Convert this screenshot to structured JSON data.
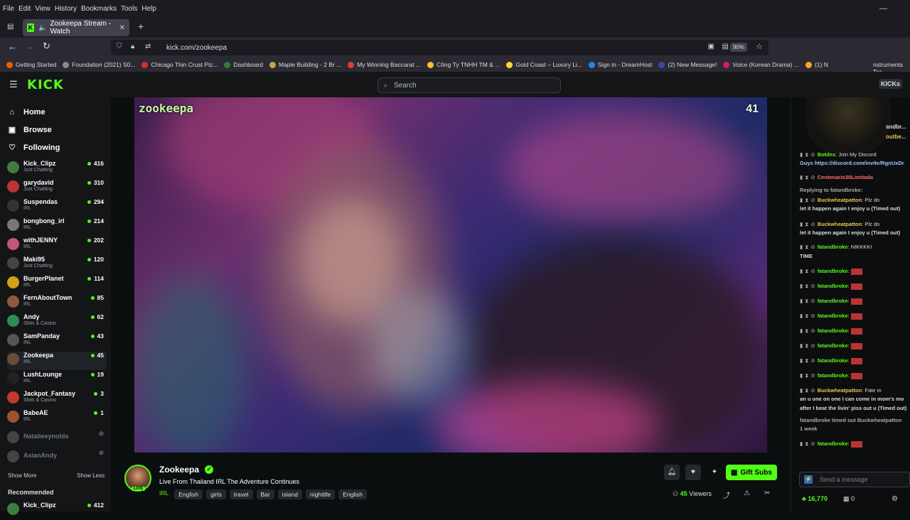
{
  "browser": {
    "menu": [
      "File",
      "Edit",
      "View",
      "History",
      "Bookmarks",
      "Tools",
      "Help"
    ],
    "tab_title": "Zookeepa Stream - Watch",
    "url": "kick.com/zookeepa",
    "zoom": "90%",
    "bookmarks": [
      {
        "label": "Getting Started",
        "color": "#e66000"
      },
      {
        "label": "Foundation (2021) S0...",
        "color": "#8a8a8a"
      },
      {
        "label": "Chicago Thin Crust Piz...",
        "color": "#d32f2f"
      },
      {
        "label": "Dashboard",
        "color": "#2e7d32"
      },
      {
        "label": "Maple Building - 2 Br ...",
        "color": "#c8a24a"
      },
      {
        "label": "My Winning Baccarat ...",
        "color": "#e53935"
      },
      {
        "label": "Công Ty TNHH TM & ...",
        "color": "#fbc02d"
      },
      {
        "label": "Gold Coast – Luxury Li...",
        "color": "#fdd835"
      },
      {
        "label": "Sign in - DreamHost",
        "color": "#1e88e5"
      },
      {
        "label": "(2) New Message!",
        "color": "#3949ab"
      },
      {
        "label": "Voice (Korean Drama) ...",
        "color": "#d81b60"
      },
      {
        "label": "(1) N",
        "color": "#f9a825"
      }
    ],
    "bookmarks_right": "nstruments Tra"
  },
  "kick": {
    "logo": "KICK",
    "search_placeholder": "Search",
    "kicks_label": "KICKs"
  },
  "sidebar": {
    "nav": [
      {
        "label": "Home",
        "icon": "home-icon"
      },
      {
        "label": "Browse",
        "icon": "browse-icon"
      },
      {
        "label": "Following",
        "icon": "heart-icon"
      }
    ],
    "following": [
      {
        "name": "Kick_Clipz",
        "category": "Just Chatting",
        "viewers": "416",
        "color": "#3f7d3f"
      },
      {
        "name": "garydavid",
        "category": "Just Chatting",
        "viewers": "310",
        "color": "#b33"
      },
      {
        "name": "Suspendas",
        "category": "IRL",
        "viewers": "294",
        "color": "#333"
      },
      {
        "name": "bongbong_irl",
        "category": "IRL",
        "viewers": "214",
        "color": "#777"
      },
      {
        "name": "withJENNY",
        "category": "IRL",
        "viewers": "202",
        "color": "#c2557a"
      },
      {
        "name": "Maki95",
        "category": "Just Chatting",
        "viewers": "120",
        "color": "#444"
      },
      {
        "name": "BurgerPlanet",
        "category": "IRL",
        "viewers": "114",
        "color": "#d4a017"
      },
      {
        "name": "FernAboutTown",
        "category": "IRL",
        "viewers": "85",
        "color": "#8b5a3c"
      },
      {
        "name": "Andy",
        "category": "Slots & Casino",
        "viewers": "62",
        "color": "#2e8b57"
      },
      {
        "name": "SamPanday",
        "category": "IRL",
        "viewers": "43",
        "color": "#555"
      },
      {
        "name": "Zookeepa",
        "category": "IRL",
        "viewers": "45",
        "color": "#6a4a3a"
      },
      {
        "name": "LushLounge",
        "category": "IRL",
        "viewers": "19",
        "color": "#222"
      },
      {
        "name": "Jackpot_Fantasy",
        "category": "Slots & Casino",
        "viewers": "3",
        "color": "#c0392b"
      },
      {
        "name": "BabeAE",
        "category": "IRL",
        "viewers": "1",
        "color": "#a0522d"
      }
    ],
    "offline": [
      "Natalieeynolds",
      "AsianAndy"
    ],
    "show_more": "Show More",
    "show_less": "Show Less",
    "recommended_title": "Recommended",
    "recommended": [
      {
        "name": "Kick_Clipz",
        "viewers": "412"
      }
    ]
  },
  "video": {
    "watermark": "zookeepa",
    "corner": "41"
  },
  "stream": {
    "name": "Zookeepa",
    "live": "LIVE",
    "title": "Live From Thailand IRL The Adventure Continues",
    "category": "IRL",
    "tags": [
      "English",
      "girls",
      "travel",
      "Bar",
      "island",
      "nightlife",
      "English"
    ],
    "viewers": "45",
    "viewers_label": "Viewers",
    "gift_label": "Gift Subs"
  },
  "chat": {
    "top_text": "andbr...",
    "top_text2": "outbe...",
    "messages": [
      {
        "user": "Botdex",
        "text": "Join My Discord",
        "color": "#53fc18"
      },
      {
        "user": "Guys https://discord.com/invite/RgnUxDr",
        "text": "",
        "color": "#9ecbff"
      },
      {
        "user": "Centenario30Limitada",
        "text": "",
        "color": "#ff6b6b"
      },
      {
        "user": "Replying to fatandbroke:",
        "text": "",
        "color": "#aaa"
      },
      {
        "user": "Buckwheatpatton",
        "text": "Plz do",
        "color": "#e6c84a"
      },
      {
        "user": "let it happen again I enjoy u (Timed out)",
        "text": "",
        "color": "#ddd"
      },
      {
        "user": "Buckwheatpatton",
        "text": "Plz do",
        "color": "#e6c84a"
      },
      {
        "user": "let it happen again I enjoy u (Timed out)",
        "text": "",
        "color": "#ddd"
      },
      {
        "user": "fatandbroke",
        "text": "NIKKKKI",
        "color": "#53fc18"
      },
      {
        "user": "TIME",
        "text": "",
        "color": "#ddd"
      },
      {
        "user": "fatandbroke",
        "text": "",
        "color": "#53fc18"
      },
      {
        "user": "fatandbroke",
        "text": "",
        "color": "#53fc18"
      },
      {
        "user": "fatandbroke",
        "text": "",
        "color": "#53fc18"
      },
      {
        "user": "fatandbroke",
        "text": "",
        "color": "#53fc18"
      },
      {
        "user": "fatandbroke",
        "text": "",
        "color": "#53fc18"
      },
      {
        "user": "fatandbroke",
        "text": "",
        "color": "#53fc18"
      },
      {
        "user": "fatandbroke",
        "text": "",
        "color": "#53fc18"
      },
      {
        "user": "fatandbroke",
        "text": "",
        "color": "#53fc18"
      },
      {
        "user": "Buckwheatpatton",
        "text": "Fate m",
        "color": "#e6c84a"
      },
      {
        "user": "an u one on one I can come in mom's mo",
        "text": "",
        "color": "#ddd"
      },
      {
        "user": "after I beat the livin' piss out u (Timed out)",
        "text": "",
        "color": "#ddd"
      },
      {
        "user": "fatandbroke timed out Buckwheatpatton",
        "text": "",
        "color": "#aaa"
      },
      {
        "user": "1 week",
        "text": "",
        "color": "#aaa"
      },
      {
        "user": "fatandbroke",
        "text": "",
        "color": "#53fc18"
      }
    ],
    "input_placeholder": "Send a message",
    "points": "16,770",
    "count": "0"
  }
}
